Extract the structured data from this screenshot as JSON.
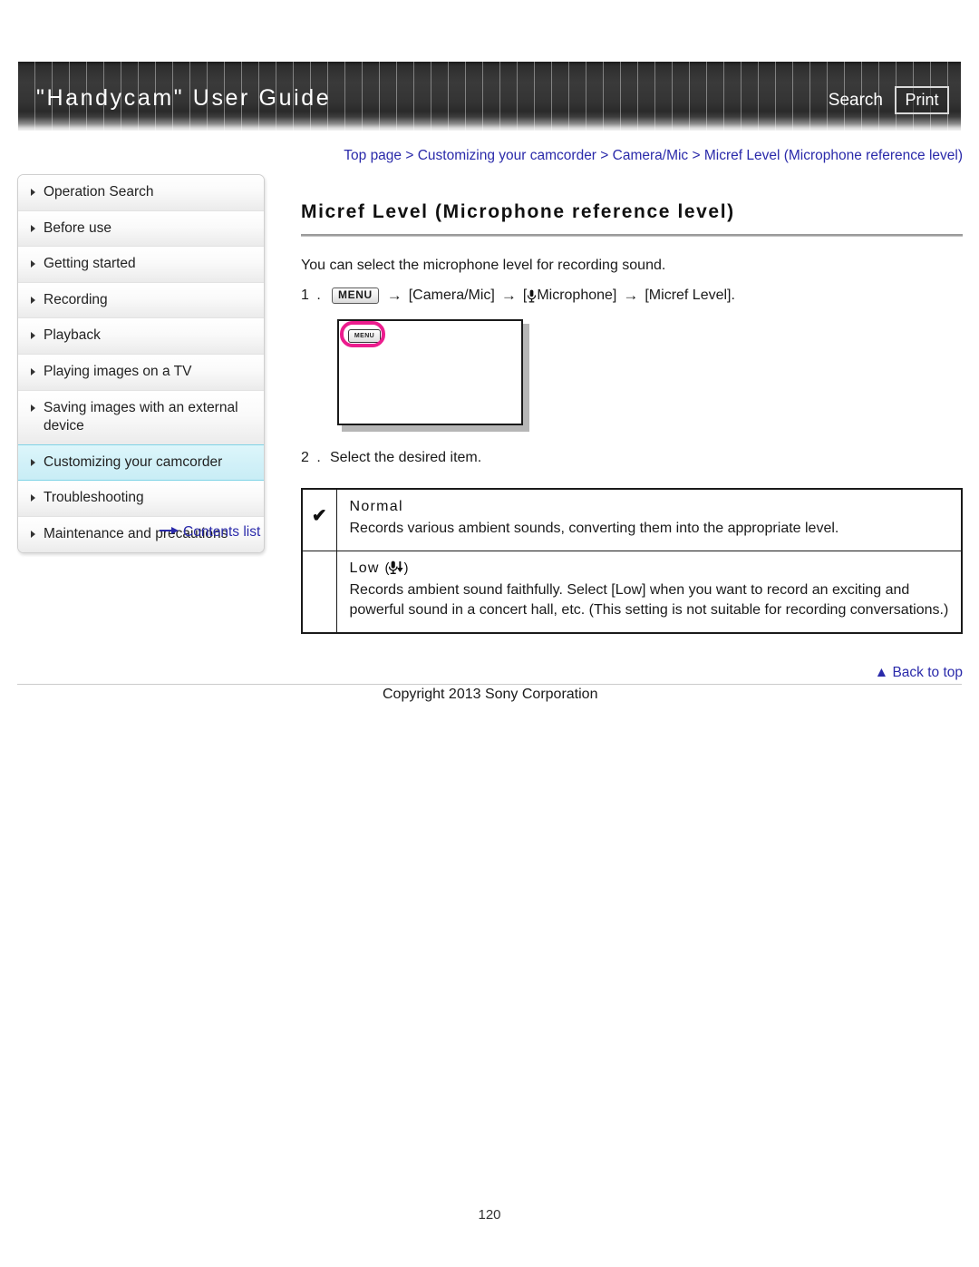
{
  "header": {
    "title": "\"Handycam\" User Guide",
    "search_label": "Search",
    "print_label": "Print"
  },
  "breadcrumb": {
    "text": "Top page > Customizing your camcorder > Camera/Mic > Micref Level (Microphone reference level)"
  },
  "sidebar": {
    "items": [
      {
        "label": "Operation Search",
        "active": false
      },
      {
        "label": "Before use",
        "active": false
      },
      {
        "label": "Getting started",
        "active": false
      },
      {
        "label": "Recording",
        "active": false
      },
      {
        "label": "Playback",
        "active": false
      },
      {
        "label": "Playing images on a TV",
        "active": false
      },
      {
        "label": "Saving images with an external device",
        "active": false
      },
      {
        "label": "Customizing your camcorder",
        "active": true
      },
      {
        "label": "Troubleshooting",
        "active": false
      },
      {
        "label": "Maintenance and precautions",
        "active": false
      }
    ],
    "contents_link": "Contents list",
    "contents_icon": "right-arrow-icon"
  },
  "main": {
    "page_title": "Micref Level (Microphone reference level)",
    "intro": "You can select the microphone level for recording sound.",
    "steps": [
      {
        "number": "1 .",
        "menu_chip": "MENU",
        "arrow": "→",
        "part1": "[Camera/Mic]",
        "mic_icon": "🎙",
        "part2": "Microphone]",
        "bracket_open": "[",
        "part3": "[Micref Level]."
      },
      {
        "number": "2 .",
        "text": "Select the desired item."
      }
    ],
    "illustration": {
      "menu_button_label": "MENU",
      "highlight_color": "#ec1d8e"
    },
    "options": [
      {
        "checked": true,
        "check_glyph": "✔",
        "name": "Normal",
        "icon": "",
        "description": "Records various ambient sounds, converting them into the appropriate level."
      },
      {
        "checked": false,
        "check_glyph": "",
        "name": "Low",
        "icon": "(🎙↓)",
        "description": "Records ambient sound faithfully. Select [Low] when you want to record an exciting and powerful sound in a concert hall, etc. (This setting is not suitable for recording conversations.)"
      }
    ]
  },
  "footer": {
    "back_to_top": "▲ Back to top",
    "copyright": "Copyright 2013 Sony Corporation",
    "page_number": "120"
  }
}
